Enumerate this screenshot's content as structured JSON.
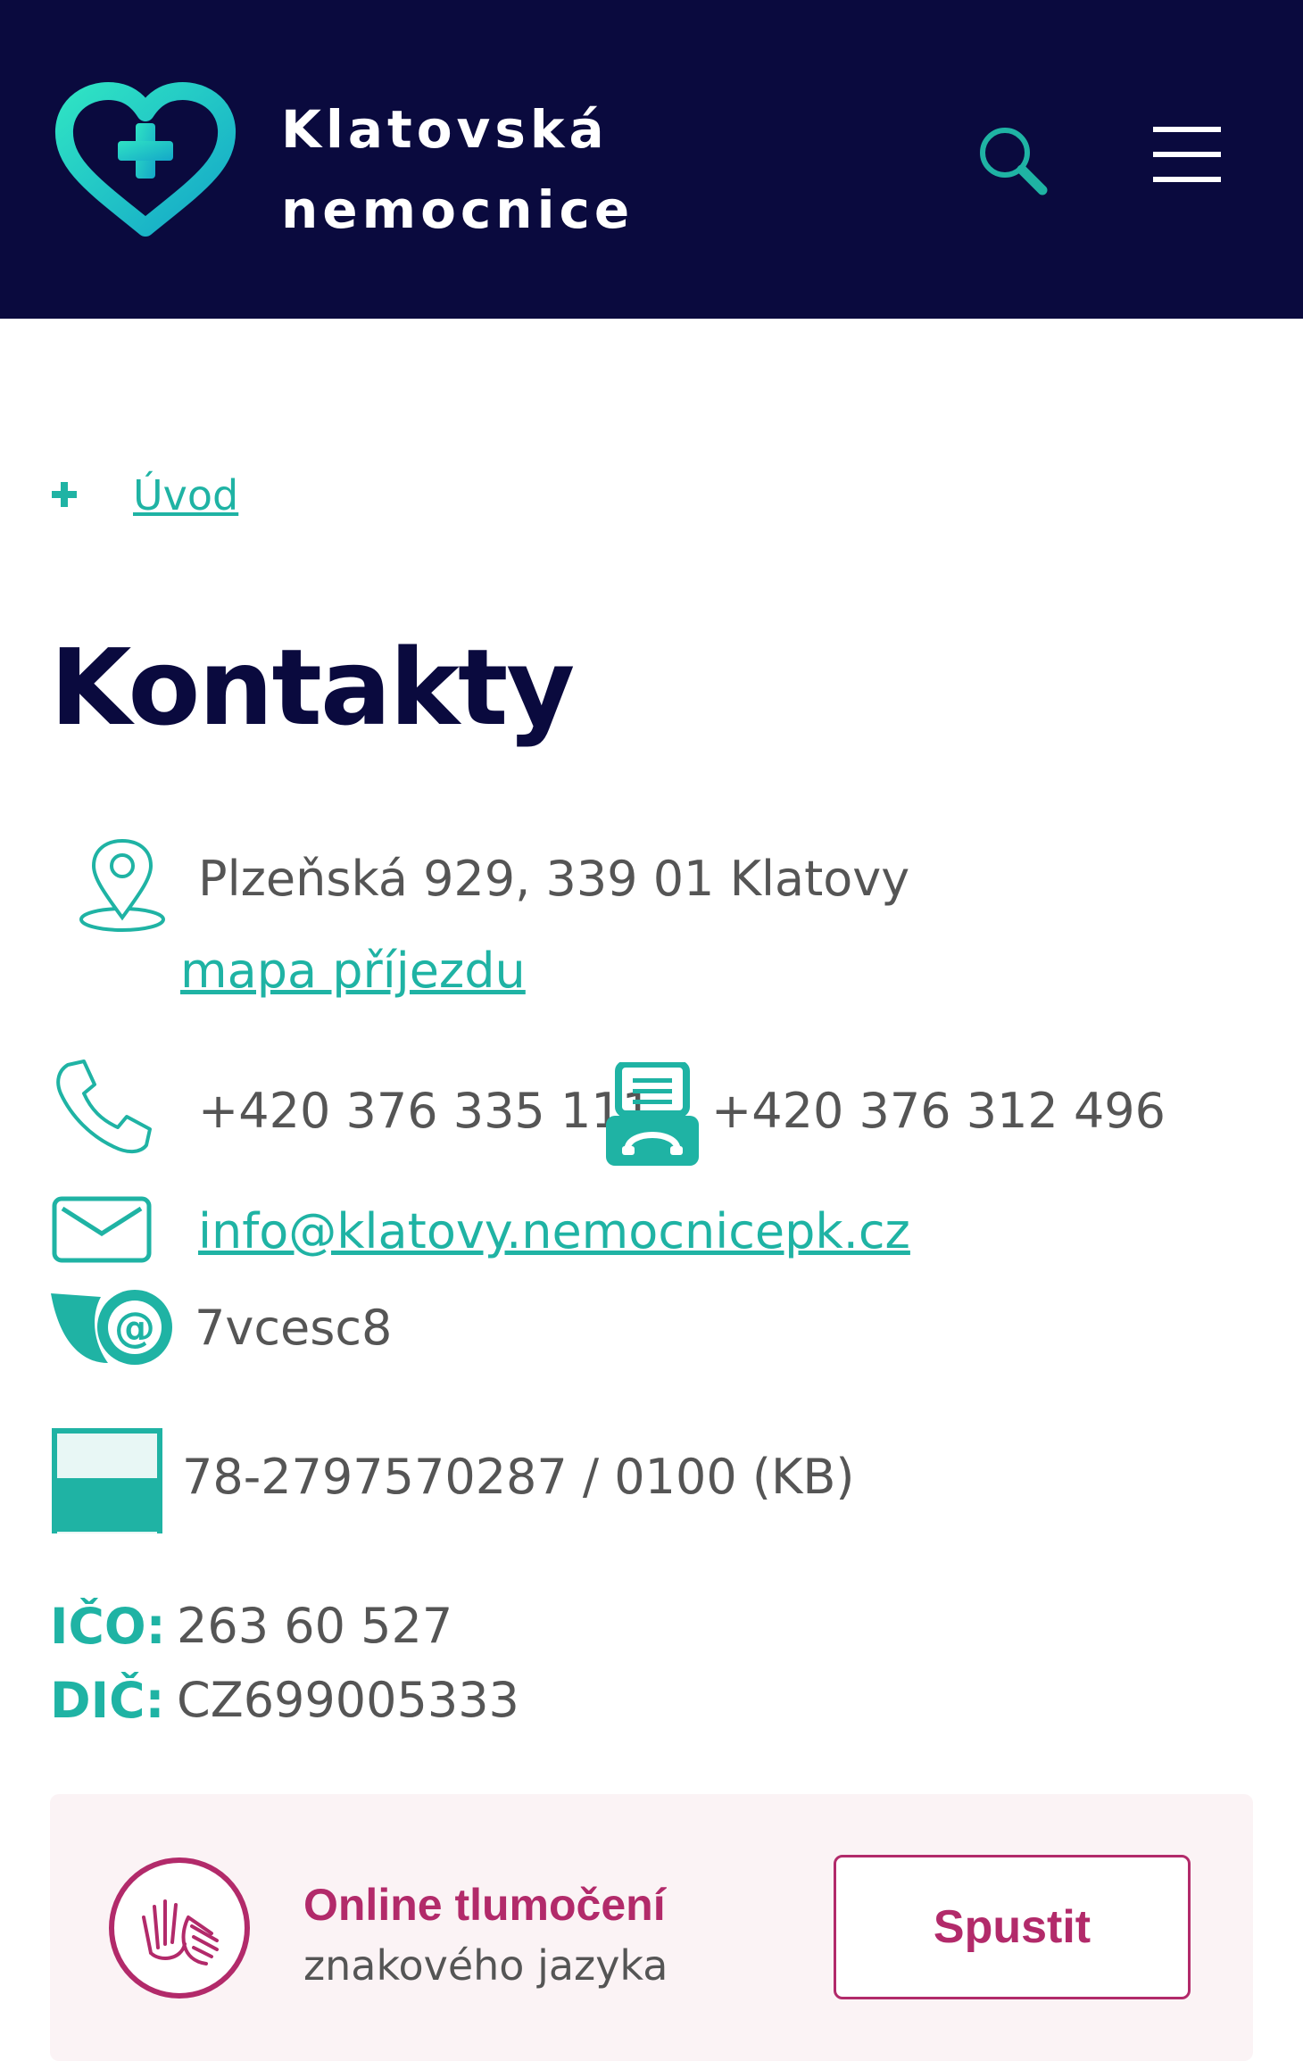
{
  "header": {
    "logo_line1": "Klatovská",
    "logo_line2": "nemocnice",
    "search_icon": "search-icon",
    "menu_icon": "hamburger-menu-icon"
  },
  "breadcrumb": {
    "home_label": "Úvod"
  },
  "page": {
    "title": "Kontakty"
  },
  "contacts": {
    "address": "Plzeňská 929, 339 01 Klatovy",
    "map_link": "mapa příjezdu",
    "phone": "+420 376 335 111",
    "fax": "+420 376 312 496",
    "email": "info@klatovy.nemocnicepk.cz",
    "data_box": "7vcesc8",
    "bank_account": "78-2797570287 / 0100 (KB)",
    "ico_label": "IČO:",
    "ico_value": "263 60 527",
    "dic_label": "DIČ:",
    "dic_value": "CZ699005333"
  },
  "sign_language": {
    "title": "Online tlumočení",
    "subtitle": "znakového jazyka",
    "button_label": "Spustit"
  },
  "colors": {
    "header_bg": "#0a0a3e",
    "accent_teal": "#1fb3a4",
    "title_navy": "#0a0a3e",
    "accent_magenta": "#b22a6a",
    "panel_bg": "#fbf3f5",
    "body_text": "#555555"
  }
}
